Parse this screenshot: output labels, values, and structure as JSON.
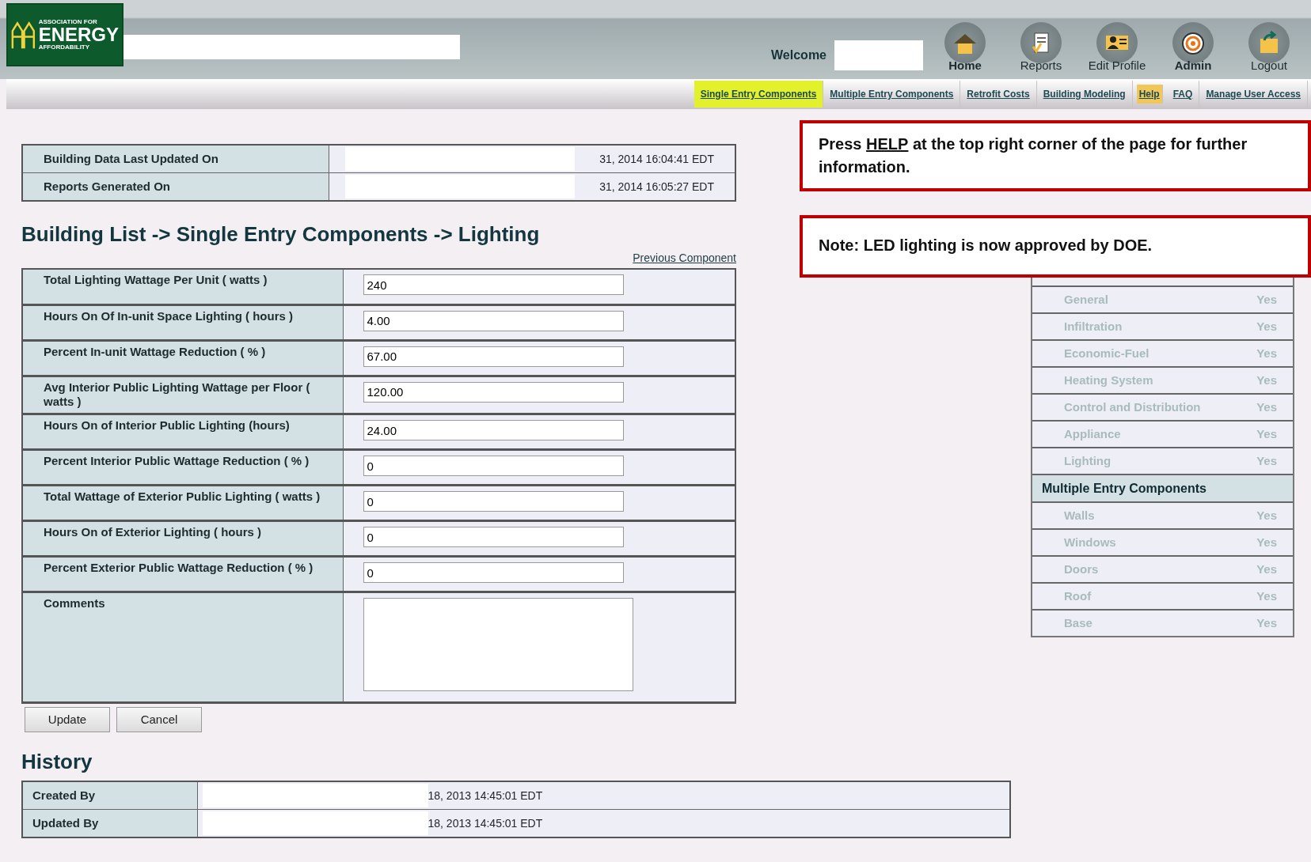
{
  "header": {
    "logo": {
      "line1": "ASSOCIATION FOR",
      "line2": "ENERGY",
      "line3": "AFFORDABILITY"
    },
    "welcome": "Welcome",
    "toolbar": [
      {
        "kind": "home",
        "label": "Home"
      },
      {
        "kind": "reports",
        "label": "Reports"
      },
      {
        "kind": "profile",
        "label": "Edit Profile"
      },
      {
        "kind": "admin",
        "label": "Admin"
      },
      {
        "kind": "logout",
        "label": "Logout"
      }
    ]
  },
  "nav": [
    {
      "label": "Single Entry Components",
      "selected": true,
      "highlighted": false
    },
    {
      "label": "Multiple Entry Components",
      "selected": false,
      "highlighted": false
    },
    {
      "label": "Retrofit Costs",
      "selected": false,
      "highlighted": false
    },
    {
      "label": "Building Modeling",
      "selected": false,
      "highlighted": false
    },
    {
      "label": "Help",
      "selected": false,
      "highlighted": true
    },
    {
      "label": "FAQ",
      "selected": false,
      "highlighted": false
    },
    {
      "label": "Manage User Access",
      "selected": false,
      "highlighted": false
    }
  ],
  "info": [
    {
      "label": "Building Data Last Updated On",
      "value": "31, 2014 16:04:41 EDT"
    },
    {
      "label": "Reports Generated On",
      "value": "31, 2014 16:05:27 EDT"
    }
  ],
  "heading": "Building List -> Single Entry Components -> Lighting",
  "previous_link": "Previous Component",
  "form": [
    {
      "kind": "text",
      "label": "Total Lighting Wattage Per Unit ( watts )",
      "value": "240"
    },
    {
      "kind": "text",
      "label": "Hours On Of In-unit Space Lighting ( hours )",
      "value": "4.00"
    },
    {
      "kind": "text",
      "label": "Percent In-unit Wattage Reduction ( % )",
      "value": "67.00"
    },
    {
      "kind": "text",
      "label": "Avg Interior Public Lighting Wattage per Floor ( watts )",
      "value": "120.00"
    },
    {
      "kind": "text",
      "label": "Hours On of Interior Public Lighting (hours)",
      "value": "24.00"
    },
    {
      "kind": "text",
      "label": "Percent Interior Public Wattage Reduction ( % )",
      "value": "0"
    },
    {
      "kind": "text",
      "label": "Total Wattage of Exterior Public Lighting ( watts )",
      "value": "0"
    },
    {
      "kind": "text",
      "label": "Hours On of Exterior Lighting ( hours )",
      "value": "0"
    },
    {
      "kind": "text",
      "label": "Percent Exterior Public Wattage Reduction ( % )",
      "value": "0"
    },
    {
      "kind": "textarea",
      "label": "Comments"
    }
  ],
  "buttons": [
    "Update",
    "Cancel"
  ],
  "history": {
    "title": "History",
    "rows": [
      {
        "label": "Created By",
        "value": "18, 2013 14:45:01 EDT"
      },
      {
        "label": "Updated By",
        "value": "18, 2013 14:45:01 EDT"
      }
    ]
  },
  "notes": [
    "Press **HELP** at the top right corner of the page for further information.",
    "Note: LED lighting is now approved by DOE."
  ],
  "sidebar": [
    {
      "kind": "item",
      "label": "General",
      "status": "Yes"
    },
    {
      "kind": "item",
      "label": "Infiltration",
      "status": "Yes"
    },
    {
      "kind": "item",
      "label": "Economic-Fuel",
      "status": "Yes"
    },
    {
      "kind": "item",
      "label": "Heating System",
      "status": "Yes"
    },
    {
      "kind": "item",
      "label": "Control and Distribution",
      "status": "Yes"
    },
    {
      "kind": "item",
      "label": "Appliance",
      "status": "Yes"
    },
    {
      "kind": "item",
      "label": "Lighting",
      "status": "Yes"
    },
    {
      "kind": "header",
      "label": "Multiple Entry Components"
    },
    {
      "kind": "item",
      "label": "Walls",
      "status": "Yes"
    },
    {
      "kind": "item",
      "label": "Windows",
      "status": "Yes"
    },
    {
      "kind": "item",
      "label": "Doors",
      "status": "Yes"
    },
    {
      "kind": "item",
      "label": "Roof",
      "status": "Yes"
    },
    {
      "kind": "item",
      "label": "Base",
      "status": "Yes"
    }
  ]
}
